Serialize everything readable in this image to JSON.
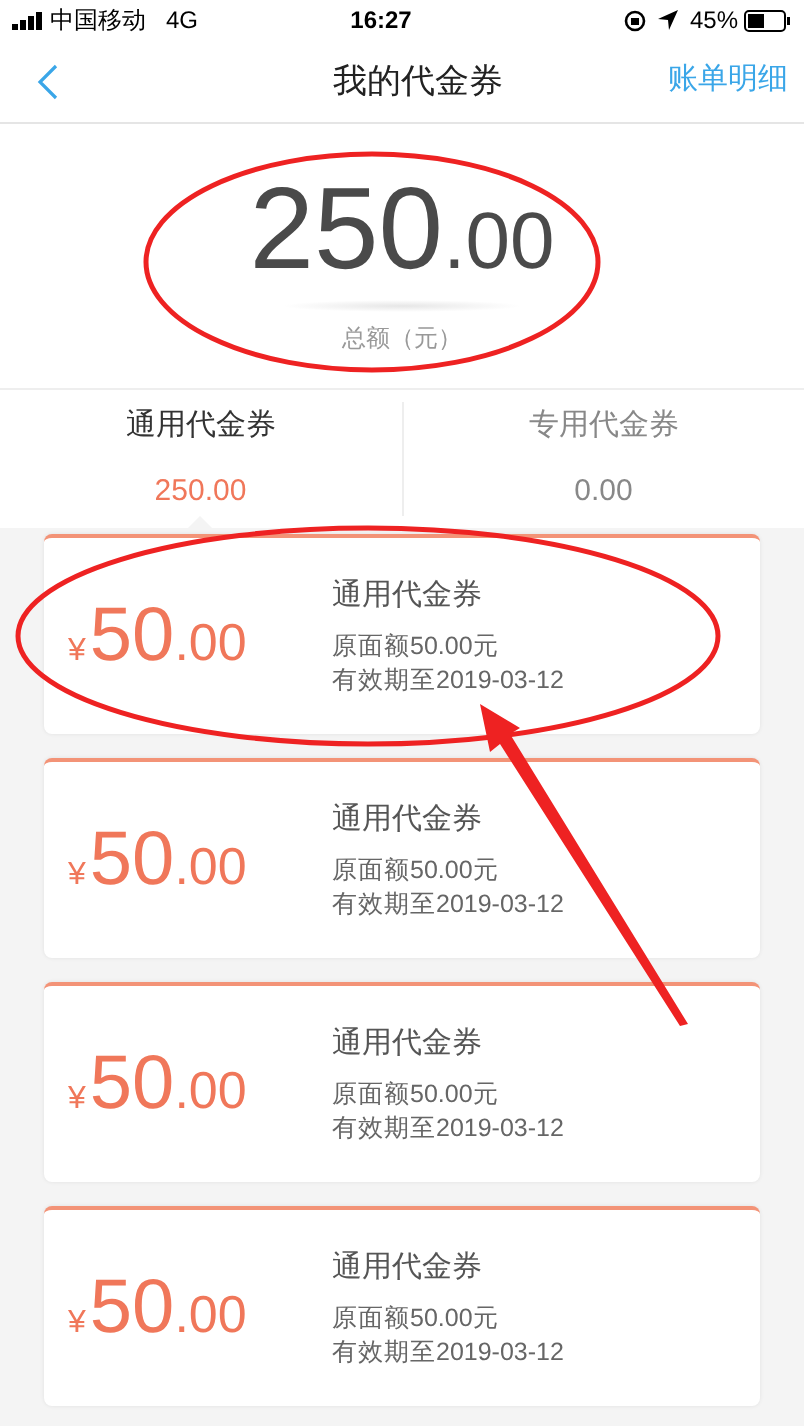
{
  "status_bar": {
    "carrier": "中国移动",
    "network": "4G",
    "time": "16:27",
    "battery": "45%"
  },
  "nav": {
    "title": "我的代金券",
    "action": "账单明细"
  },
  "total": {
    "integer": "250",
    "decimal": ".00",
    "label": "总额（元）"
  },
  "tabs": [
    {
      "label": "通用代金券",
      "amount": "250.00",
      "selected": true
    },
    {
      "label": "专用代金券",
      "amount": "0.00",
      "selected": false
    }
  ],
  "coupons": [
    {
      "currency": "¥",
      "integer": "50",
      "decimal": ".00",
      "title": "通用代金券",
      "face_value": "原面额50.00元",
      "expiry": "有效期至2019-03-12"
    },
    {
      "currency": "¥",
      "integer": "50",
      "decimal": ".00",
      "title": "通用代金券",
      "face_value": "原面额50.00元",
      "expiry": "有效期至2019-03-12"
    },
    {
      "currency": "¥",
      "integer": "50",
      "decimal": ".00",
      "title": "通用代金券",
      "face_value": "原面额50.00元",
      "expiry": "有效期至2019-03-12"
    },
    {
      "currency": "¥",
      "integer": "50",
      "decimal": ".00",
      "title": "通用代金券",
      "face_value": "原面额50.00元",
      "expiry": "有效期至2019-03-12"
    }
  ]
}
